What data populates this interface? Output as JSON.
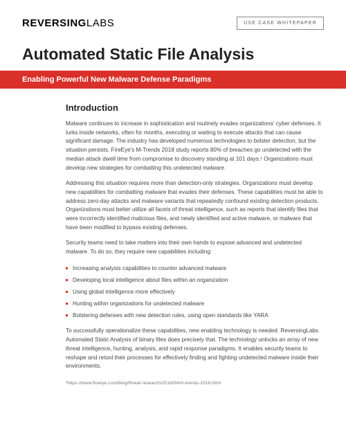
{
  "header": {
    "logo_prefix": "REVERSING",
    "logo_suffix": "LABS",
    "badge": "USE CASE WHITEPAPER"
  },
  "title": "Automated Static File Analysis",
  "subtitle": "Enabling Powerful New Malware Defense Paradigms",
  "section_heading": "Introduction",
  "paragraphs": {
    "p1": "Malware continues to increase in sophistication and routinely evades organizations' cyber defenses. It lurks inside networks, often for months, executing or waiting to execute attacks that can cause significant damage. The industry has developed numerous technologies to bolster detection, but the situation persists. FireEye's M-Trends 2018 study reports 80% of breaches go undetected with the median attack dwell time from compromise to discovery standing at 101 days.¹ Organizations must develop new strategies for combatting this undetected malware.",
    "p2": "Addressing this situation requires more than detection-only strategies. Organizations must develop new capabilities for combatting malware that evades their defenses. These capabilities must be able to address zero-day attacks and malware variants that repeatedly confound existing detection products. Organizations must better utilize all facets of threat intelligence, such as reports that identify files that were incorrectly identified malicious files, and newly identified and active malware, or malware that have been modified to bypass existing defenses.",
    "p3": "Security teams need to take matters into their own hands to expose advanced and undetected malware. To do so, they require new capabilities including:",
    "p4": "To successfully operationalize these capabilities, new enabling technology is needed. ReversingLabs Automated Static Analysis of binary files does precisely that. The technology unlocks an array of new threat intelligence, hunting, analysis, and rapid response paradigms. It enables security teams to reshape and retool their processes for effectively finding and fighting undetected malware inside their environments."
  },
  "bullets": [
    "Increasing analysis capabilities to counter advanced malware",
    "Developing local intelligence about files within an organization",
    "Using global intelligence more effectively",
    "Hunting within organizations for undetected malware",
    "Bolstering defenses with new detection rules, using open standards like YARA"
  ],
  "footnote": "¹https://www.fireeye.com/blog/threat-research/2018/04/m-trends-2018.html"
}
